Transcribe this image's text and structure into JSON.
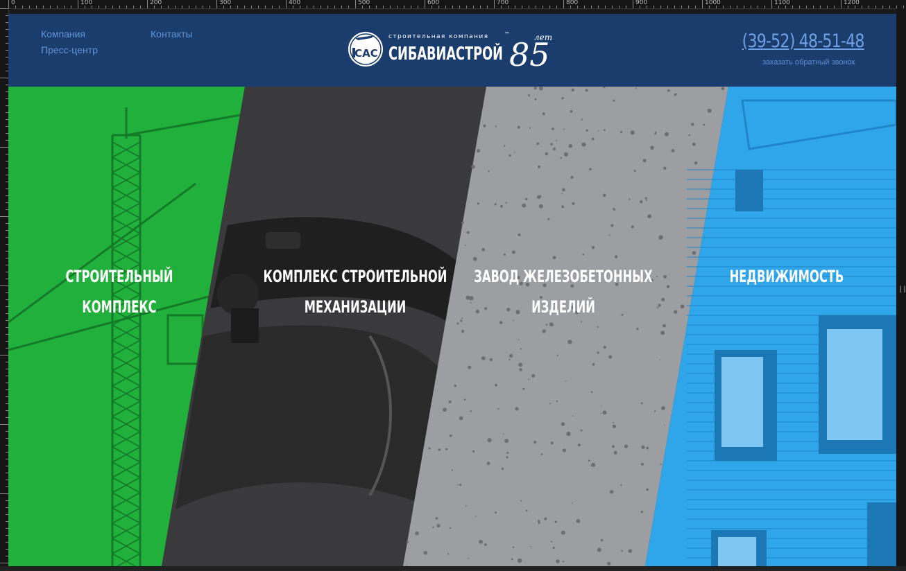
{
  "ruler": {
    "labels": [
      "0",
      "100",
      "200",
      "300",
      "400",
      "500",
      "600",
      "700",
      "800",
      "900",
      "1000",
      "1100",
      "1200"
    ]
  },
  "header": {
    "nav": [
      "Компания",
      "Контакты",
      "Пресс-центр"
    ],
    "logo": {
      "badge": "САС",
      "tagline": "строительная компания",
      "tm": "™",
      "name": "СИБАВИАСТРОЙ",
      "anniversary_number": "85",
      "anniversary_word": "лет"
    },
    "phone": "(39-52)  48-51-48",
    "callback": "заказать обратный звонок"
  },
  "sections": [
    {
      "title": "СТРОИТЕЛЬНЫЙ КОМПЛЕКС",
      "color": "#22b03c"
    },
    {
      "title": "КОМПЛЕКС СТРОИТЕЛЬНОЙ\nМЕХАНИЗАЦИИ",
      "color": "#3a3a3c"
    },
    {
      "title": "ЗАВОД ЖЕЛЕЗОБЕТОННЫХ\nИЗДЕЛИЙ",
      "color": "#9c9ea2"
    },
    {
      "title": "НЕДВИЖИМОСТЬ",
      "color": "#2fa5ea"
    }
  ],
  "colors": {
    "header_bg": "#1b3d6e",
    "nav_link": "#5f95d6",
    "phone": "#6ea0e2"
  }
}
